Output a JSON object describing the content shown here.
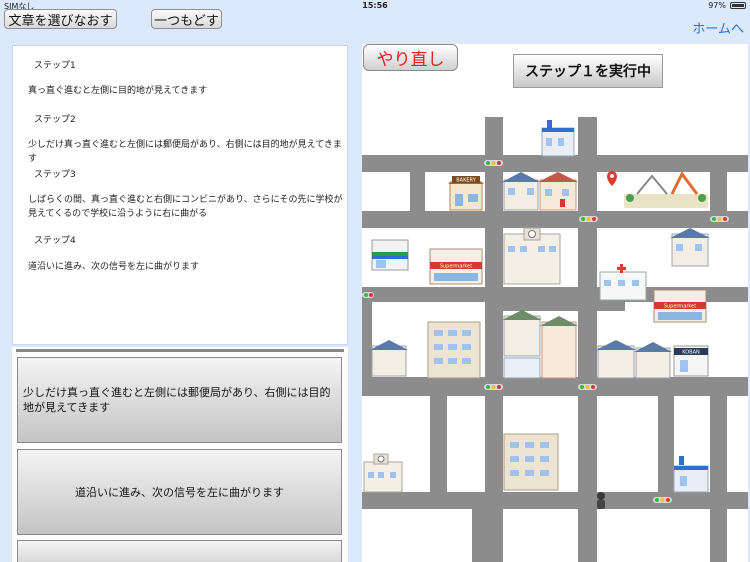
{
  "statusbar": {
    "carrier": "SIMなし",
    "time": "15:56",
    "battery": "97%",
    "battery_level": 0.97
  },
  "top": {
    "choose_label": "文章を選びなおす",
    "back_label": "一つもどす",
    "home_label": "ホームへ"
  },
  "steps": [
    {
      "title": "ステップ1",
      "text": "真っ直ぐ進むと左側に目的地が見えてきます"
    },
    {
      "title": "ステップ2",
      "text": "少しだけ真っ直ぐ進むと左側には郵便局があり、右側には目的地が見えてきます"
    },
    {
      "title": "ステップ3",
      "text": "しばらくの間、真っ直ぐ進むと右側にコンビニがあり、さらにその先に学校が見えてくるので学校に沿うように右に曲がる"
    },
    {
      "title": "ステップ4",
      "text": "道沿いに進み、次の信号を左に曲がります"
    }
  ],
  "choices": [
    "少しだけ真っ直ぐ進むと左側には郵便局があり、右側には目的地が見えてきます",
    "道沿いに進み、次の信号を左に曲がります",
    ""
  ],
  "map": {
    "redo_label": "やり直し",
    "status_label": "ステップ１を実行中",
    "sign_bakery": "BAKERY",
    "sign_supermarket": "Supermarket",
    "sign_koban": "KOBAN",
    "colors": {
      "road": "#8c8c8c",
      "redo_text": "#e02020",
      "link": "#1a73e8",
      "background": "#dce8fb"
    }
  }
}
